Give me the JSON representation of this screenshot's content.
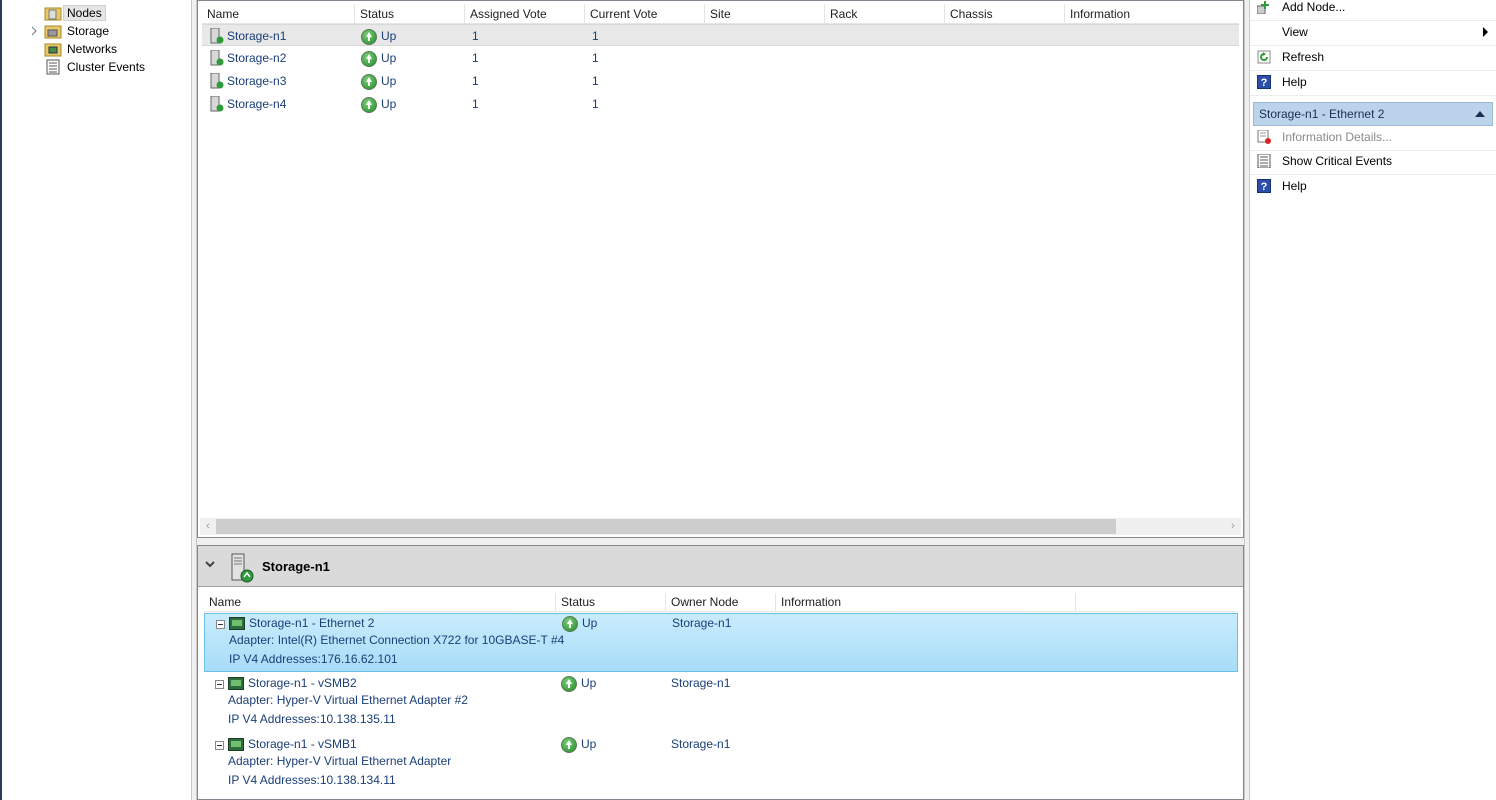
{
  "tree": {
    "items": [
      {
        "label": "Nodes",
        "icon": "folder-nodes-icon",
        "selected": true
      },
      {
        "label": "Storage",
        "icon": "folder-storage-icon"
      },
      {
        "label": "Networks",
        "icon": "networks-icon"
      },
      {
        "label": "Cluster Events",
        "icon": "cluster-events-icon"
      }
    ]
  },
  "nodes_grid": {
    "columns": [
      "Name",
      "Status",
      "Assigned Vote",
      "Current Vote",
      "Site",
      "Rack",
      "Chassis",
      "Information"
    ],
    "rows": [
      {
        "name": "Storage-n1",
        "status": "Up",
        "assigned_vote": "1",
        "current_vote": "1"
      },
      {
        "name": "Storage-n2",
        "status": "Up",
        "assigned_vote": "1",
        "current_vote": "1"
      },
      {
        "name": "Storage-n3",
        "status": "Up",
        "assigned_vote": "1",
        "current_vote": "1"
      },
      {
        "name": "Storage-n4",
        "status": "Up",
        "assigned_vote": "1",
        "current_vote": "1"
      }
    ]
  },
  "detail": {
    "title": "Storage-n1",
    "columns": [
      "Name",
      "Status",
      "Owner Node",
      "Information"
    ],
    "networks": [
      {
        "name": "Storage-n1 - Ethernet 2",
        "adapter": "Adapter: Intel(R) Ethernet Connection X722 for 10GBASE-T #4",
        "ip": "IP V4 Addresses:176.16.62.101",
        "status": "Up",
        "owner": "Storage-n1"
      },
      {
        "name": "Storage-n1 - vSMB2",
        "adapter": "Adapter: Hyper-V Virtual Ethernet Adapter #2",
        "ip": "IP V4 Addresses:10.138.135.11",
        "status": "Up",
        "owner": "Storage-n1"
      },
      {
        "name": "Storage-n1 - vSMB1",
        "adapter": "Adapter: Hyper-V Virtual Ethernet Adapter",
        "ip": "IP V4 Addresses:10.138.134.11",
        "status": "Up",
        "owner": "Storage-n1"
      }
    ]
  },
  "actions": {
    "top": [
      {
        "label": "Add Node...",
        "icon": "add-node-icon"
      },
      {
        "label": "View",
        "icon": "",
        "submenu": true
      },
      {
        "label": "Refresh",
        "icon": "refresh-icon"
      },
      {
        "label": "Help",
        "icon": "help-icon"
      }
    ],
    "section_title": "Storage-n1 - Ethernet 2",
    "section": [
      {
        "label": "Information Details...",
        "icon": "information-details-icon",
        "disabled": true
      },
      {
        "label": "Show Critical Events",
        "icon": "critical-events-icon"
      },
      {
        "label": "Help",
        "icon": "help-icon"
      }
    ]
  },
  "colors": {
    "selection_blue": "#a8dcf7",
    "link_text": "#1a3e78",
    "section_header": "#bcd3ec",
    "status_up": "#1f8a1f"
  }
}
